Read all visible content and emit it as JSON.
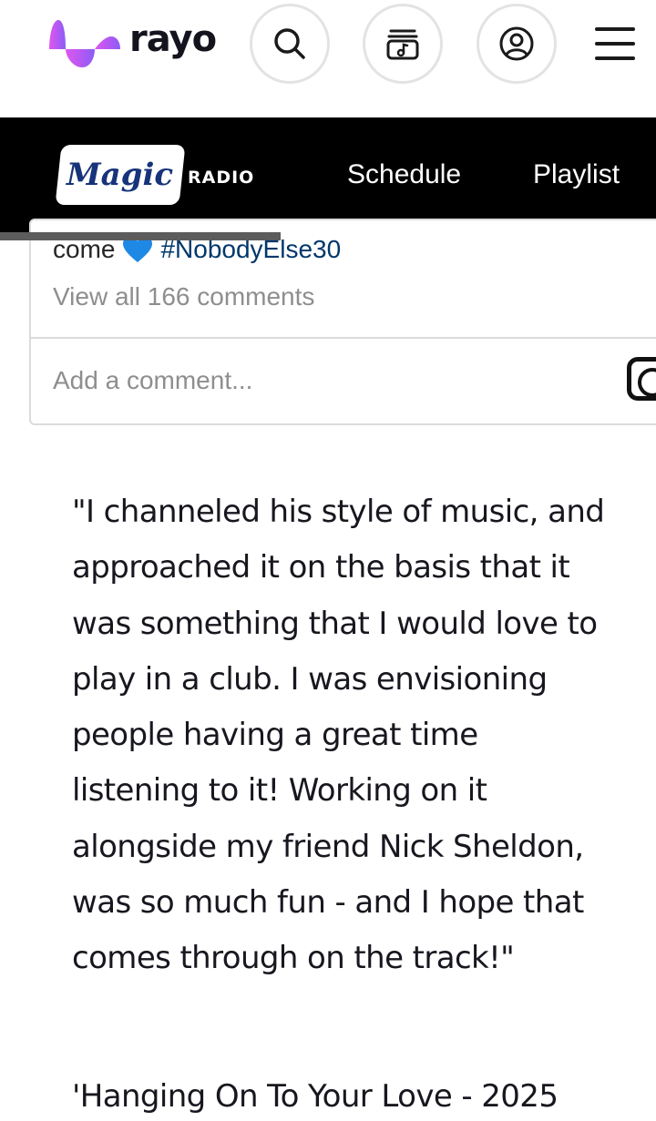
{
  "header": {
    "brand": "rayo",
    "icons": {
      "search": "search-icon",
      "music": "music-box-icon",
      "account": "account-icon",
      "menu": "hamburger-icon"
    }
  },
  "station_nav": {
    "logo_word": "Magic",
    "logo_sub": "RADIO",
    "links": [
      "Schedule",
      "Playlist"
    ]
  },
  "instagram_embed": {
    "caption_tail_word": "come",
    "caption_hashtag": "#NobodyElse30",
    "view_comments": "View all 166 comments",
    "comment_placeholder": "Add a comment..."
  },
  "article": {
    "quote": "\"I channeled his style of music, and approached it on the basis that it was something that I would love to play in a club. I was envisioning people having a great time listening to it! Working on it alongside my friend Nick Sheldon, was so much fun - and I hope that comes through on the track!\"",
    "next_heading": "'Hanging On To Your Love - 2025"
  },
  "colors": {
    "brand_gradient_start": "#d64fe6",
    "brand_gradient_end": "#8b5cf6",
    "magic_blue": "#17337a",
    "hashtag_blue": "#00376b",
    "heart_blue": "#1e88e5"
  }
}
